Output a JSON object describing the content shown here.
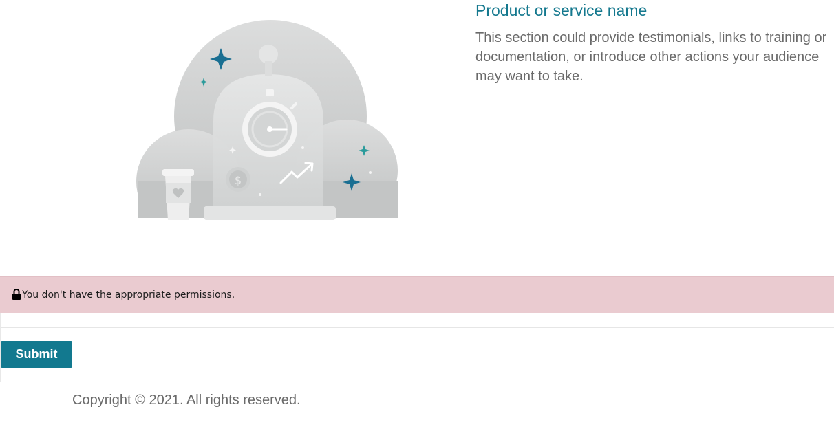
{
  "product": {
    "title": "Product or service name",
    "description": "This section could provide testimonials, links to training or documentation, or introduce other actions your audience may want to take."
  },
  "alert": {
    "icon": "lock-icon",
    "message": "You don't have the appropriate permissions."
  },
  "form": {
    "submit_label": "Submit"
  },
  "footer": {
    "copyright": "Copyright © 2021. All rights reserved."
  },
  "colors": {
    "accent": "#12798f",
    "title": "#14788e",
    "alert_background": "#eacbd0",
    "body_text": "#6a6a6a"
  }
}
